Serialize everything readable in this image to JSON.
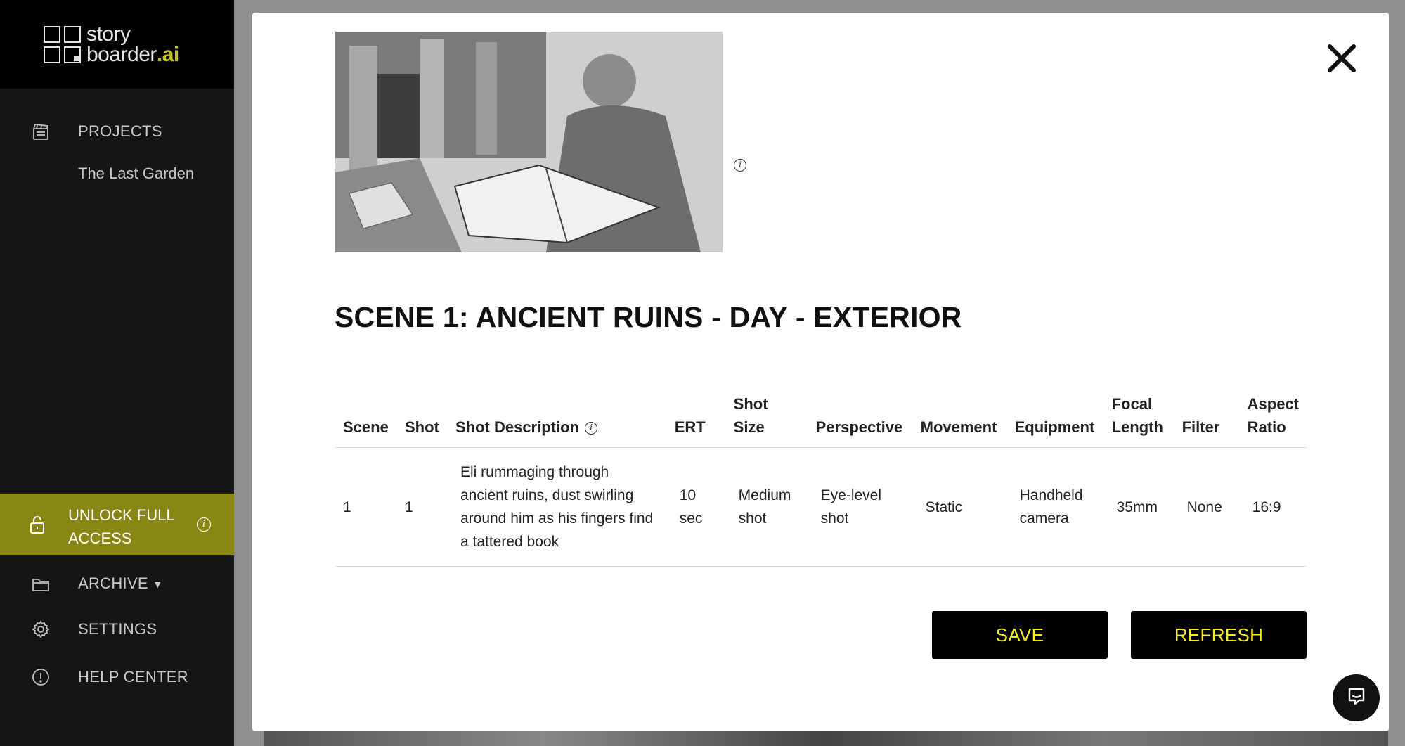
{
  "brand": {
    "line1": "story",
    "line2": "boarder",
    "suffix": ".ai"
  },
  "sidebar": {
    "projects_label": "PROJECTS",
    "project_name": "The Last Garden",
    "unlock_label": "UNLOCK FULL ACCESS",
    "archive_label": "ARCHIVE",
    "settings_label": "SETTINGS",
    "help_label": "HELP CENTER"
  },
  "modal": {
    "scene_title": "SCENE 1: ANCIENT RUINS - DAY - EXTERIOR",
    "save_label": "SAVE",
    "refresh_label": "REFRESH"
  },
  "table": {
    "headers": {
      "scene": "Scene",
      "shot": "Shot",
      "description": "Shot Description",
      "ert": "ERT",
      "shot_size": "Shot Size",
      "perspective": "Perspective",
      "movement": "Movement",
      "equipment": "Equipment",
      "focal_length": "Focal Length",
      "filter": "Filter",
      "aspect_ratio": "Aspect Ratio"
    },
    "rows": [
      {
        "scene": "1",
        "shot": "1",
        "description": "Eli rummaging through ancient ruins, dust swirling around him as his fingers find a tattered book",
        "ert": "10 sec",
        "shot_size": "Medium shot",
        "perspective": "Eye-level shot",
        "movement": "Static",
        "equipment": "Handheld camera",
        "focal_length": "35mm",
        "filter": "None",
        "aspect_ratio": "16:9"
      }
    ]
  },
  "colors": {
    "accent": "#f5ee17",
    "unlock_bg": "#898714",
    "sidebar_bg": "#151515"
  },
  "icons": [
    "clapperboard-icon",
    "lock-icon",
    "info-icon",
    "folder-icon",
    "gear-icon",
    "alert-circle-icon",
    "close-icon",
    "chat-icon"
  ]
}
